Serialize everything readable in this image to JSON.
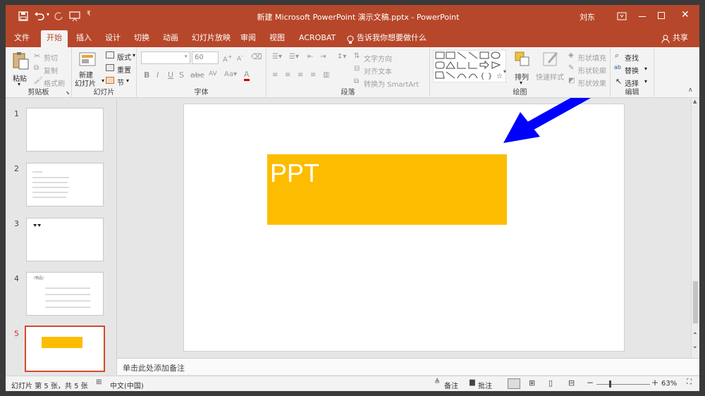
{
  "titlebar": {
    "title": "新建 Microsoft PowerPoint 演示文稿.pptx  -  PowerPoint",
    "user": "刘东"
  },
  "tabs": [
    "文件",
    "开始",
    "插入",
    "设计",
    "切换",
    "动画",
    "幻灯片放映",
    "审阅",
    "视图",
    "ACROBAT"
  ],
  "tell_me": "告诉我你想要做什么",
  "share": "共享",
  "ribbon": {
    "clipboard": {
      "paste": "粘贴",
      "cut": "剪切",
      "copy": "复制",
      "format_painter": "格式刷",
      "label": "剪贴板"
    },
    "slides": {
      "new_slide_1": "新建",
      "new_slide_2": "幻灯片",
      "layout": "版式",
      "reset": "重置",
      "section": "节",
      "label": "幻灯片"
    },
    "font": {
      "font_size": "60",
      "label": "字体"
    },
    "paragraph": {
      "text_direction": "文字方向",
      "align_text": "对齐文本",
      "convert_smartart": "转换为 SmartArt",
      "label": "段落"
    },
    "drawing": {
      "arrange": "排列",
      "quick_styles": "快速样式",
      "shape_fill": "形状填充",
      "shape_outline": "形状轮廓",
      "shape_effects": "形状效果",
      "label": "绘图"
    },
    "editing": {
      "find": "查找",
      "replace": "替换",
      "select": "选择",
      "label": "编辑"
    }
  },
  "slides_panel": {
    "numbers": [
      "1",
      "2",
      "3",
      "4",
      "5"
    ],
    "thumb4_title": "(物品)"
  },
  "slide": {
    "shape_text": "PPT"
  },
  "notes_placeholder": "单击此处添加备注",
  "status": {
    "slide_info": "幻灯片 第 5 张，共 5 张",
    "language": "中文(中国)",
    "notes": "备注",
    "comments": "批注",
    "zoom": "63%"
  },
  "colors": {
    "accent": "#b7472a",
    "shape_fill": "#fcbd00",
    "arrow": "#0000ff"
  }
}
